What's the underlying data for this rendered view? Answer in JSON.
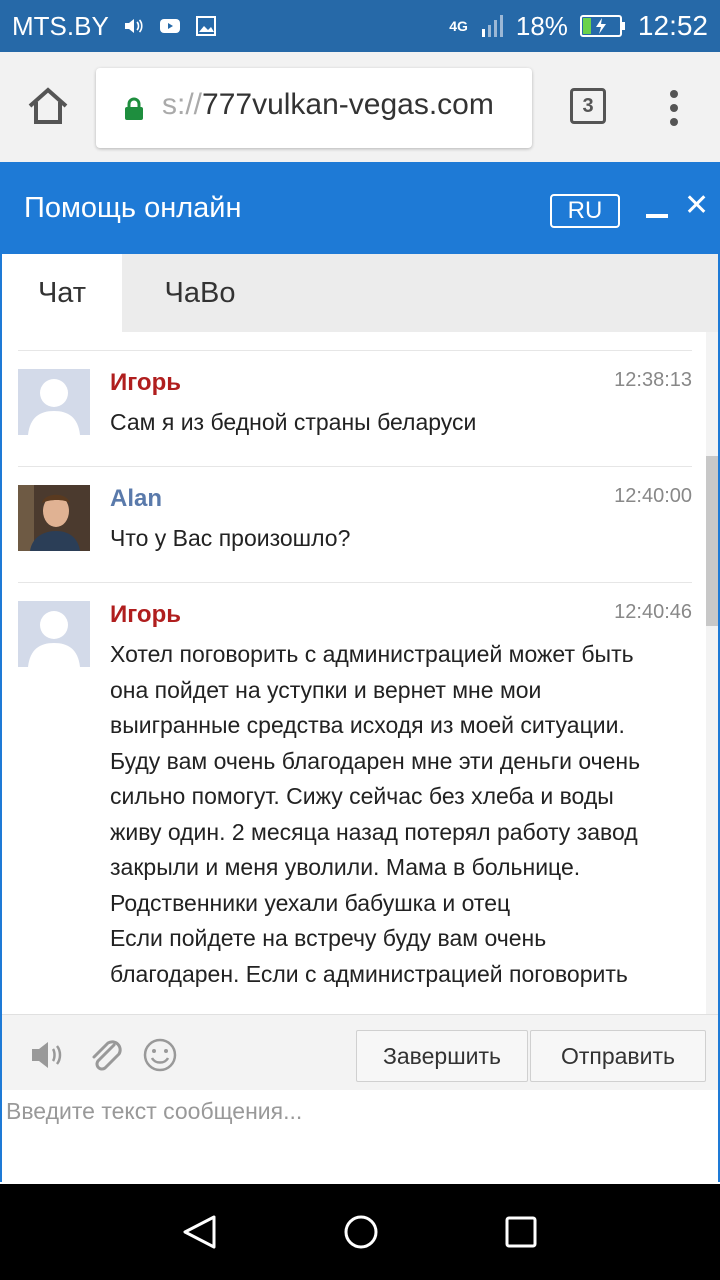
{
  "status_bar": {
    "carrier": "MTS.BY",
    "network": "4G",
    "battery": "18%",
    "time": "12:52"
  },
  "browser": {
    "url_scheme_fragment": "s://",
    "url_host": "777vulkan-vegas.com",
    "tab_count": "3"
  },
  "widget": {
    "title": "Помощь онлайн",
    "language": "RU",
    "tabs": [
      {
        "label": "Чат"
      },
      {
        "label": "ЧаВо"
      }
    ],
    "messages": [
      {
        "author": "Игорь",
        "role": "user",
        "time": "12:38:13",
        "lines": [
          "Сам я из бедной страны беларуси"
        ]
      },
      {
        "author": "Alan",
        "role": "agent",
        "time": "12:40:00",
        "lines": [
          "Что у Вас произошло?"
        ]
      },
      {
        "author": "Игорь",
        "role": "user",
        "time": "12:40:46",
        "lines": [
          "Хотел поговорить с администрацией может быть",
          "она пойдет на уступки и вернет мне мои",
          "выигранные средства исходя из моей ситуации.",
          "Буду вам очень благодарен мне эти деньги очень",
          "сильно помогут. Сижу сейчас без хлеба и воды",
          "живу один. 2 месяца назад потерял работу завод",
          "закрыли и меня уволили. Мама в больнице.",
          "Родственники уехали бабушка и отец",
          "Если пойдете на встречу буду вам очень",
          "благодарен. Если с администрацией поговорить"
        ]
      }
    ],
    "toolbar": {
      "finish_label": "Завершить",
      "send_label": "Отправить"
    },
    "input": {
      "placeholder": "Введите текст сообщения..."
    },
    "colors": {
      "header": "#1e7ad6",
      "user_name": "#b01e1e",
      "agent_name": "#5a7aab"
    }
  }
}
